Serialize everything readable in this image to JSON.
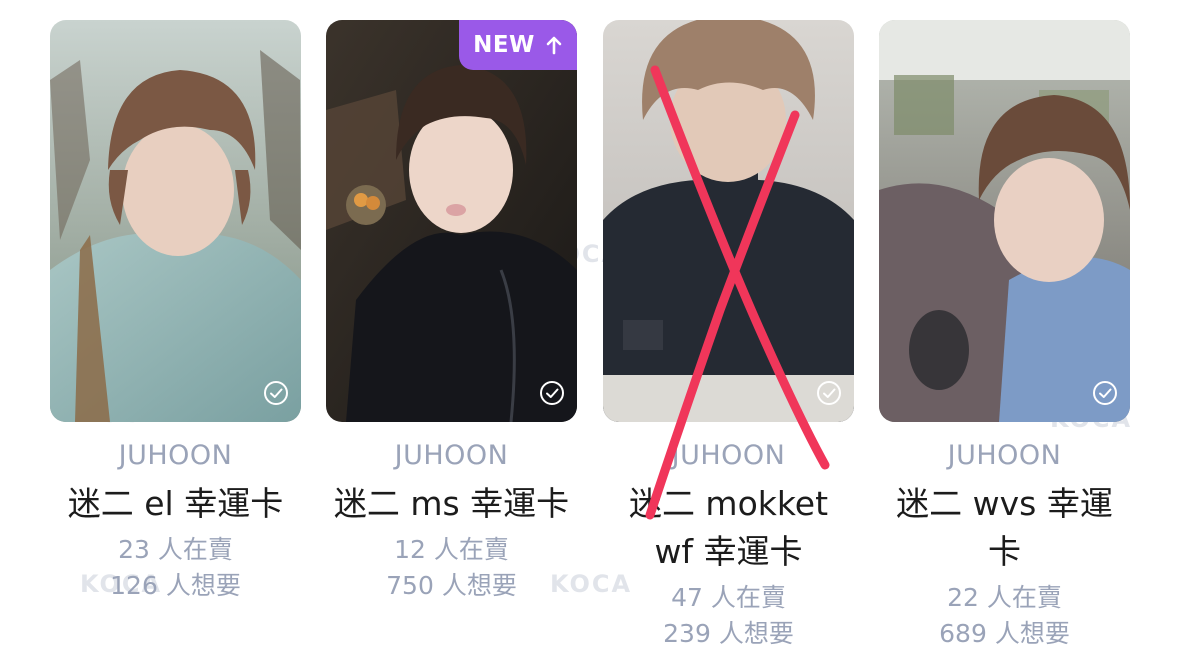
{
  "cards": [
    {
      "member": "JUHOON",
      "title": "迷二 el 幸運卡",
      "sellers": "23 人在賣",
      "wanters": "126 人想要",
      "new_badge": null,
      "crossed_out": false
    },
    {
      "member": "JUHOON",
      "title": "迷二 ms 幸運卡",
      "sellers": "12 人在賣",
      "wanters": "750 人想要",
      "new_badge": "NEW",
      "crossed_out": false
    },
    {
      "member": "JUHOON",
      "title": "迷二 mokket wf 幸運卡",
      "sellers": "47 人在賣",
      "wanters": "239 人想要",
      "new_badge": null,
      "crossed_out": true
    },
    {
      "member": "JUHOON",
      "title": "迷二 wvs 幸運卡",
      "sellers": "22 人在賣",
      "wanters": "689 人想要",
      "new_badge": null,
      "crossed_out": false
    }
  ],
  "watermark": "KOCA",
  "colors": {
    "badge": "#9a59e8",
    "muted_text": "#9aa3b8",
    "title_text": "#1c1c1c",
    "cross_mark": "#f0365a"
  },
  "icons": {
    "check": "check-circle-icon",
    "new_arrow": "arrow-up-icon"
  }
}
